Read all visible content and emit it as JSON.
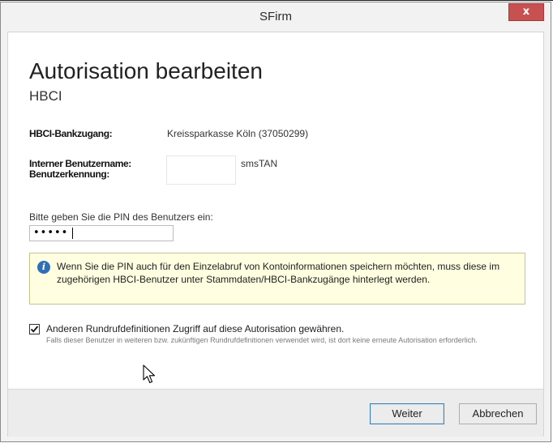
{
  "window": {
    "title": "SFirm",
    "close_label": "x"
  },
  "dialog": {
    "heading": "Autorisation bearbeiten",
    "subheading": "HBCI",
    "fields": {
      "bankzugang_label": "HBCI-Bankzugang:",
      "bankzugang_value": "Kreissparkasse Köln (37050299)",
      "benutzername_label": "Interner Benutzername:",
      "benutzerkennung_label": "Benutzerkennung:",
      "benutzername_value": "smsTAN"
    },
    "pin": {
      "label": "Bitte geben Sie die PIN des Benutzers ein:",
      "value": "•••••"
    },
    "info": {
      "text": "Wenn Sie die PIN auch für den Einzelabruf von Kontoinformationen speichern möchten, muss diese im zugehörigen HBCI-Benutzer unter Stammdaten/HBCI-Bankzugänge hinterlegt werden."
    },
    "share_access": {
      "checked": true,
      "label": "Anderen Rundrufdefinitionen Zugriff auf diese Autorisation gewähren.",
      "hint": "Falls dieser Benutzer in weiteren bzw. zukünftigen Rundrufdefinitionen verwendet wird, ist dort keine erneute Autorisation erforderlich."
    },
    "buttons": {
      "next": "Weiter",
      "cancel": "Abbrechen"
    }
  },
  "colors": {
    "close_button": "#c75050",
    "info_background": "#fffee0",
    "info_icon": "#2f6fb8",
    "primary_button_border": "#3c7fb1"
  }
}
